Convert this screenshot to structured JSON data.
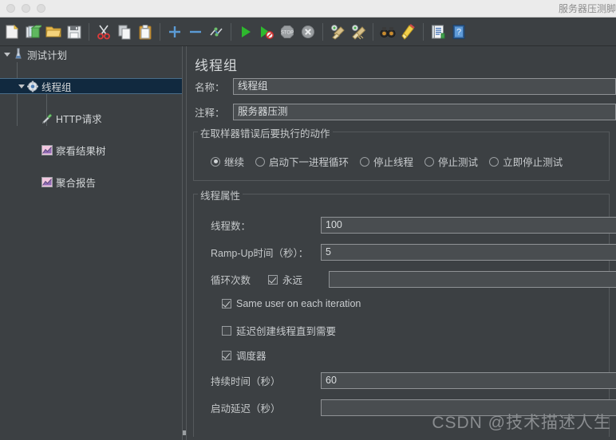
{
  "window": {
    "title": "服务器压测脚",
    "traffic_lights": [
      "close-button",
      "minimize-button",
      "zoom-button"
    ]
  },
  "toolbar": {
    "buttons": [
      {
        "name": "new-icon",
        "label": "新建"
      },
      {
        "name": "templates-icon",
        "label": "模板"
      },
      {
        "name": "open-icon",
        "label": "打开"
      },
      {
        "name": "save-icon",
        "label": "保存"
      },
      {
        "name": "cut-icon",
        "label": "剪切"
      },
      {
        "name": "copy-icon",
        "label": "复制"
      },
      {
        "name": "paste-icon",
        "label": "粘贴"
      },
      {
        "name": "expand-all-icon",
        "label": "展开"
      },
      {
        "name": "collapse-all-icon",
        "label": "折叠"
      },
      {
        "name": "toggle-icon",
        "label": "切换"
      },
      {
        "name": "start-icon",
        "label": "启动"
      },
      {
        "name": "start-no-pauses-icon",
        "label": "无停顿启动"
      },
      {
        "name": "stop-icon",
        "label": "停止"
      },
      {
        "name": "shutdown-icon",
        "label": "关闭"
      },
      {
        "name": "clear-icon",
        "label": "清除"
      },
      {
        "name": "clear-all-icon",
        "label": "清除全部"
      },
      {
        "name": "search-icon",
        "label": "查找"
      },
      {
        "name": "reset-search-icon",
        "label": "重置查找"
      },
      {
        "name": "function-helper-icon",
        "label": "函数助手"
      },
      {
        "name": "help-icon",
        "label": "帮助"
      }
    ]
  },
  "tree": {
    "nodes": [
      {
        "label": "测试计划",
        "icon": "test-plan-icon",
        "depth": 0,
        "expanded": true,
        "selected": false
      },
      {
        "label": "线程组",
        "icon": "thread-group-icon",
        "depth": 1,
        "expanded": true,
        "selected": true
      },
      {
        "label": "HTTP请求",
        "icon": "http-request-icon",
        "depth": 2,
        "expanded": false,
        "selected": false
      },
      {
        "label": "察看结果树",
        "icon": "view-results-tree-icon",
        "depth": 2,
        "expanded": false,
        "selected": false
      },
      {
        "label": "聚合报告",
        "icon": "aggregate-report-icon",
        "depth": 2,
        "expanded": false,
        "selected": false
      }
    ]
  },
  "main": {
    "title": "线程组",
    "name_label": "名称：",
    "name_value": "线程组",
    "comment_label": "注释：",
    "comment_value": "服务器压测",
    "action_group": {
      "title": "在取样器错误后要执行的动作",
      "options": [
        {
          "label": "继续",
          "selected": true
        },
        {
          "label": "启动下一进程循环",
          "selected": false
        },
        {
          "label": "停止线程",
          "selected": false
        },
        {
          "label": "停止测试",
          "selected": false
        },
        {
          "label": "立即停止测试",
          "selected": false
        }
      ]
    },
    "thread_group": {
      "title": "线程属性",
      "threads_label": "线程数：",
      "threads_value": "100",
      "rampup_label": "Ramp-Up时间（秒）：",
      "rampup_value": "5",
      "loops_label": "循环次数",
      "forever_label": "永远",
      "forever_checked": true,
      "loops_value": "",
      "same_user_label": "Same user on each iteration",
      "same_user_checked": true,
      "delay_create_label": "延迟创建线程直到需要",
      "delay_create_checked": false,
      "scheduler_label": "调度器",
      "scheduler_checked": true,
      "duration_label": "持续时间（秒）",
      "duration_value": "60",
      "startup_delay_label": "启动延迟（秒）",
      "startup_delay_value": ""
    }
  },
  "watermark": "CSDN @技术描述人生",
  "colors": {
    "window_bg": "#3c4043",
    "titlebar_bg": "#ebebeb",
    "selection_bg": "#11293f",
    "input_bg": "#494d50",
    "text": "#c8cbce"
  }
}
